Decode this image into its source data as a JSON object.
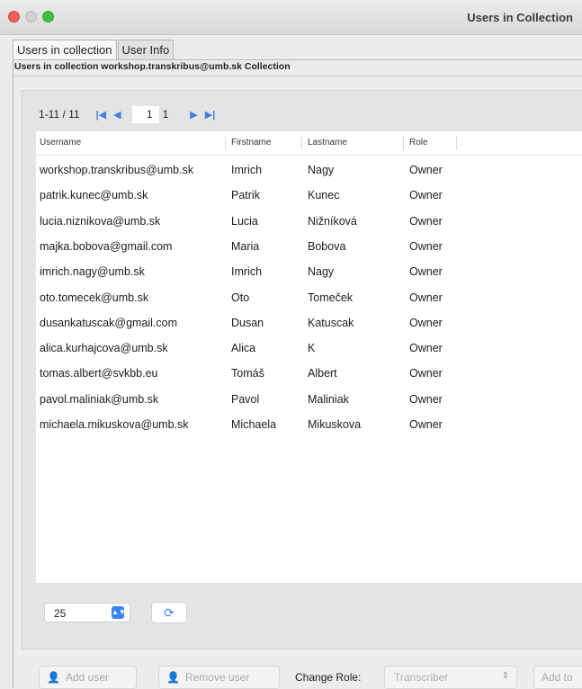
{
  "window": {
    "title": "Users in Collection"
  },
  "tabs": [
    {
      "label": "Users in collection",
      "active": true
    },
    {
      "label": "User Info",
      "active": false
    }
  ],
  "collection_header": "Users in collection workshop.transkribus@umb.sk Collection",
  "pagination": {
    "range": "1-11 / 11",
    "current_page": "1",
    "total_pages": "1"
  },
  "table": {
    "columns": [
      "Username",
      "Firstname",
      "Lastname",
      "Role"
    ],
    "rows": [
      [
        "workshop.transkribus@umb.sk",
        "Imrich",
        "Nagy",
        "Owner"
      ],
      [
        "patrik.kunec@umb.sk",
        "Patrik",
        "Kunec",
        "Owner"
      ],
      [
        "lucia.niznikova@umb.sk",
        "Lucia",
        "Nižníková",
        "Owner"
      ],
      [
        "majka.bobova@gmail.com",
        "Maria",
        "Bobova",
        "Owner"
      ],
      [
        "imrich.nagy@umb.sk",
        "Imrich",
        "Nagy",
        "Owner"
      ],
      [
        "oto.tomecek@umb.sk",
        "Oto",
        "Tomeček",
        "Owner"
      ],
      [
        "dusankatuscak@gmail.com",
        "Dusan",
        "Katuscak",
        "Owner"
      ],
      [
        "alica.kurhajcova@umb.sk",
        "Alica",
        "K",
        "Owner"
      ],
      [
        "tomas.albert@svkbb.eu",
        "Tomáš",
        "Albert",
        "Owner"
      ],
      [
        "pavol.maliniak@umb.sk",
        "Pavol",
        "Maliniak",
        "Owner"
      ],
      [
        "michaela.mikuskova@umb.sk",
        "Michaela",
        "Mikuskova",
        "Owner"
      ]
    ]
  },
  "page_size": {
    "value": "25"
  },
  "footer": {
    "add_user_label": "Add user",
    "remove_user_label": "Remove user",
    "change_role_label": "Change Role:",
    "role_select_value": "Transcriber",
    "add_to_label": "Add to"
  },
  "colors": {
    "accent": "#3b82f6",
    "close": "#ec5f57",
    "maximize": "#3cc140"
  }
}
